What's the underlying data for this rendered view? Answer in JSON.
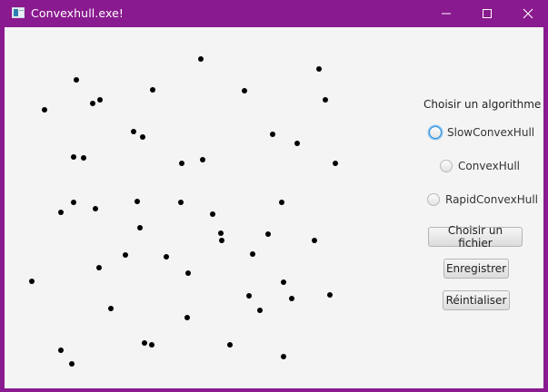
{
  "window": {
    "title": "Convexhull.exe!",
    "colors": {
      "titlebar": "#8a1a8f",
      "client_bg": "#f4f4f4",
      "point": "#000000",
      "focus": "#1e8ae0"
    }
  },
  "controls": {
    "icons": {
      "minimize": "minimize-icon",
      "maximize": "maximize-icon",
      "close": "close-icon"
    }
  },
  "panel": {
    "title": "Choisir un algorithme",
    "options": [
      {
        "label": "SlowConvexHull",
        "selected": false,
        "focused": true
      },
      {
        "label": "ConvexHull",
        "selected": false,
        "focused": false
      },
      {
        "label": "RapidConvexHull",
        "selected": false,
        "focused": false
      }
    ],
    "buttons": {
      "choose_file": "Choisir un fichier",
      "save": "Enregistrer",
      "reset": "Réintialiser"
    }
  }
}
